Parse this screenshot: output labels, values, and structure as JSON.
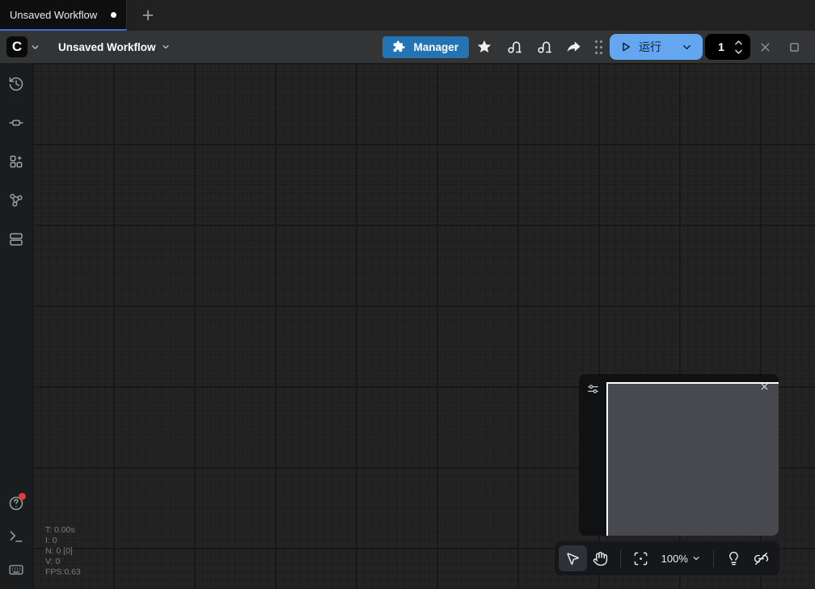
{
  "tab_bar": {
    "active_tab": {
      "label": "Unsaved Workflow"
    },
    "new_tab_label": "+"
  },
  "menu_bar": {
    "logo_letter": "C",
    "workflow_name": "Unsaved Workflow",
    "manager_button": {
      "label": "Manager"
    },
    "run_button": {
      "label": "运行"
    },
    "batch_counter": {
      "value": "1"
    }
  },
  "sidebar": {
    "top_icons": [
      "history-icon",
      "node-icon",
      "model-library-icon",
      "node-map-icon",
      "workflows-icon"
    ],
    "bottom_icons": [
      "help-icon",
      "terminal-icon",
      "keyboard-icon"
    ],
    "help_has_notification": true
  },
  "canvas": {
    "stats": {
      "lines": [
        "T: 0.00s",
        "I: 0",
        "N: 0 [0]",
        "V: 0",
        "FPS:0.63"
      ]
    }
  },
  "bottom_toolbar": {
    "zoom_level": "100%"
  },
  "colors": {
    "run_button_blue": "#64a7f0",
    "manager_blue": "#2274b5",
    "tab_underline_blue": "#3e6ed8",
    "canvas_bg": "#232323",
    "menu_bar_bg": "#333436",
    "notification_red": "#e53935",
    "minimap_viewport_gray": "#47494e"
  }
}
